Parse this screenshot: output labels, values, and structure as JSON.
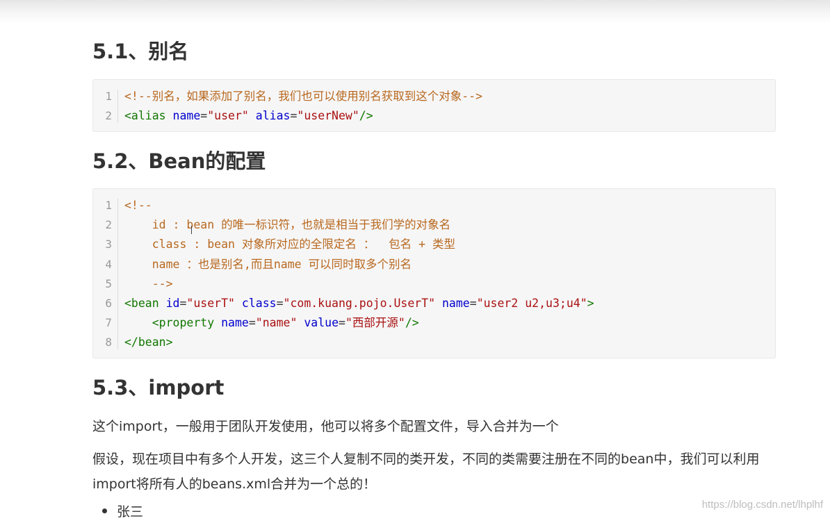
{
  "sections": [
    {
      "heading": "5.1、别名",
      "code": [
        [
          [
            "com",
            "<!--别名，如果添加了别名，我们也可以使用别名获取到这个对象-->"
          ]
        ],
        [
          [
            "tag",
            "<alias "
          ],
          [
            "attr",
            "name"
          ],
          [
            "pun",
            "="
          ],
          [
            "str",
            "\"user\""
          ],
          [
            "pun",
            " "
          ],
          [
            "attr",
            "alias"
          ],
          [
            "pun",
            "="
          ],
          [
            "str",
            "\"userNew\""
          ],
          [
            "tag",
            "/>"
          ]
        ]
      ]
    },
    {
      "heading": "5.2、Bean的配置",
      "code": [
        [
          [
            "com",
            "<!--"
          ]
        ],
        [
          [
            "com",
            "    id : bean 的唯一标识符，也就是相当于我们学的对象名"
          ]
        ],
        [
          [
            "com",
            "    class : bean 对象所对应的全限定名 ：  包名 + 类型"
          ]
        ],
        [
          [
            "com",
            "    name ：也是别名,而且name 可以同时取多个别名"
          ]
        ],
        [
          [
            "com",
            "    -->"
          ]
        ],
        [
          [
            "tag",
            "<bean "
          ],
          [
            "attr",
            "id"
          ],
          [
            "pun",
            "="
          ],
          [
            "str",
            "\"userT\""
          ],
          [
            "pun",
            " "
          ],
          [
            "attr",
            "class"
          ],
          [
            "pun",
            "="
          ],
          [
            "str",
            "\"com.kuang.pojo.UserT\""
          ],
          [
            "pun",
            " "
          ],
          [
            "attr",
            "name"
          ],
          [
            "pun",
            "="
          ],
          [
            "str",
            "\"user2 u2,u3;u4\""
          ],
          [
            "tag",
            ">"
          ]
        ],
        [
          [
            "pun",
            "    "
          ],
          [
            "tag",
            "<property "
          ],
          [
            "attr",
            "name"
          ],
          [
            "pun",
            "="
          ],
          [
            "str",
            "\"name\""
          ],
          [
            "pun",
            " "
          ],
          [
            "attr",
            "value"
          ],
          [
            "pun",
            "="
          ],
          [
            "str",
            "\"西部开源\""
          ],
          [
            "tag",
            "/>"
          ]
        ],
        [
          [
            "tag",
            "</bean>"
          ]
        ]
      ]
    },
    {
      "heading": "5.3、import"
    }
  ],
  "paragraphs": {
    "p1": "这个import，一般用于团队开发使用，他可以将多个配置文件，导入合并为一个",
    "p2": "假设，现在项目中有多个人开发，这三个人复制不同的类开发，不同的类需要注册在不同的bean中，我们可以利用import将所有人的beans.xml合并为一个总的！"
  },
  "list_items": [
    "张三"
  ],
  "watermark": "https://blog.csdn.net/lhplhf",
  "colors": {
    "comment": "#b8681e",
    "tag": "#117700",
    "attribute": "#0000cc",
    "string": "#aa1111"
  }
}
